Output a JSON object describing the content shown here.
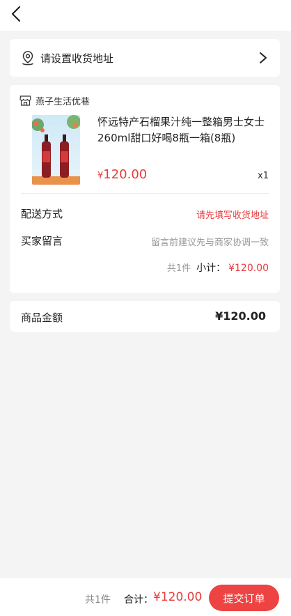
{
  "header": {
    "back_icon": "chevron-left-icon"
  },
  "address": {
    "icon": "location-pin-icon",
    "placeholder_text": "请设置收货地址",
    "arrow_icon": "chevron-right-icon"
  },
  "order": {
    "shop_icon": "storefront-icon",
    "shop_name": "燕子生活优巷",
    "product": {
      "title": "怀远特产石榴果汁纯一整箱男士女士260ml甜口好喝8瓶一箱(8瓶)",
      "price_symbol": "¥",
      "price_value": "120.00",
      "quantity": "x1"
    },
    "delivery": {
      "label": "配送方式",
      "value": "请先填写收货地址"
    },
    "message": {
      "label": "买家留言",
      "placeholder": "留言前建议先与商家协调一致"
    },
    "subtotal": {
      "count": "共1件",
      "label": "小计：",
      "amount": "¥120.00"
    }
  },
  "goods_amount": {
    "label": "商品金额",
    "value": "¥120.00"
  },
  "footer": {
    "count": "共1件",
    "total_label": "合计：",
    "total_amount": "¥120.00",
    "submit_label": "提交订单"
  },
  "colors": {
    "accent": "#e93b3b",
    "button": "#ed4343",
    "background": "#f4f4f4"
  }
}
